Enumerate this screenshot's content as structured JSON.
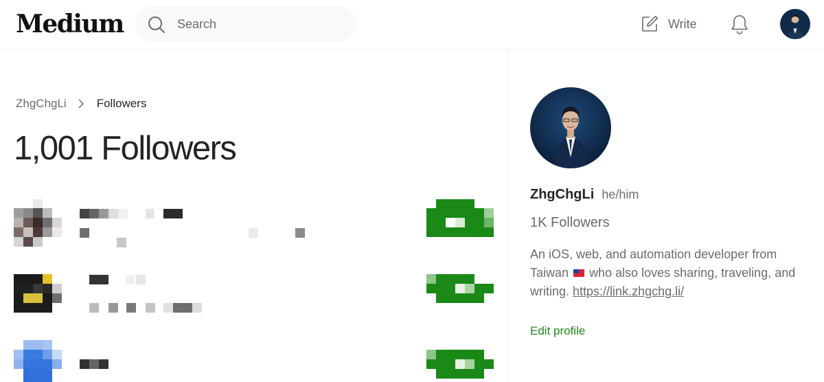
{
  "brand": {
    "logo_text": "Medium"
  },
  "search": {
    "placeholder": "Search"
  },
  "nav": {
    "write_label": "Write"
  },
  "breadcrumb": {
    "parent": "ZhgChgLi",
    "current": "Followers"
  },
  "page": {
    "title": "1,001 Followers"
  },
  "profile": {
    "name": "ZhgChgLi",
    "pronouns": "he/him",
    "followers": "1K Followers",
    "bio_text_1": "An iOS, web, and automation developer from Taiwan",
    "bio_text_2": "who also loves sharing, traveling, and writing.",
    "bio_link": "https://link.zhgchg.li/",
    "edit_label": "Edit profile"
  },
  "colors": {
    "accent_green": "#1a8917",
    "follow_button_green": "#1a8917",
    "text_primary": "#242424",
    "text_secondary": "#6b6b6b",
    "avatar_bg": "#0f2a4d"
  }
}
